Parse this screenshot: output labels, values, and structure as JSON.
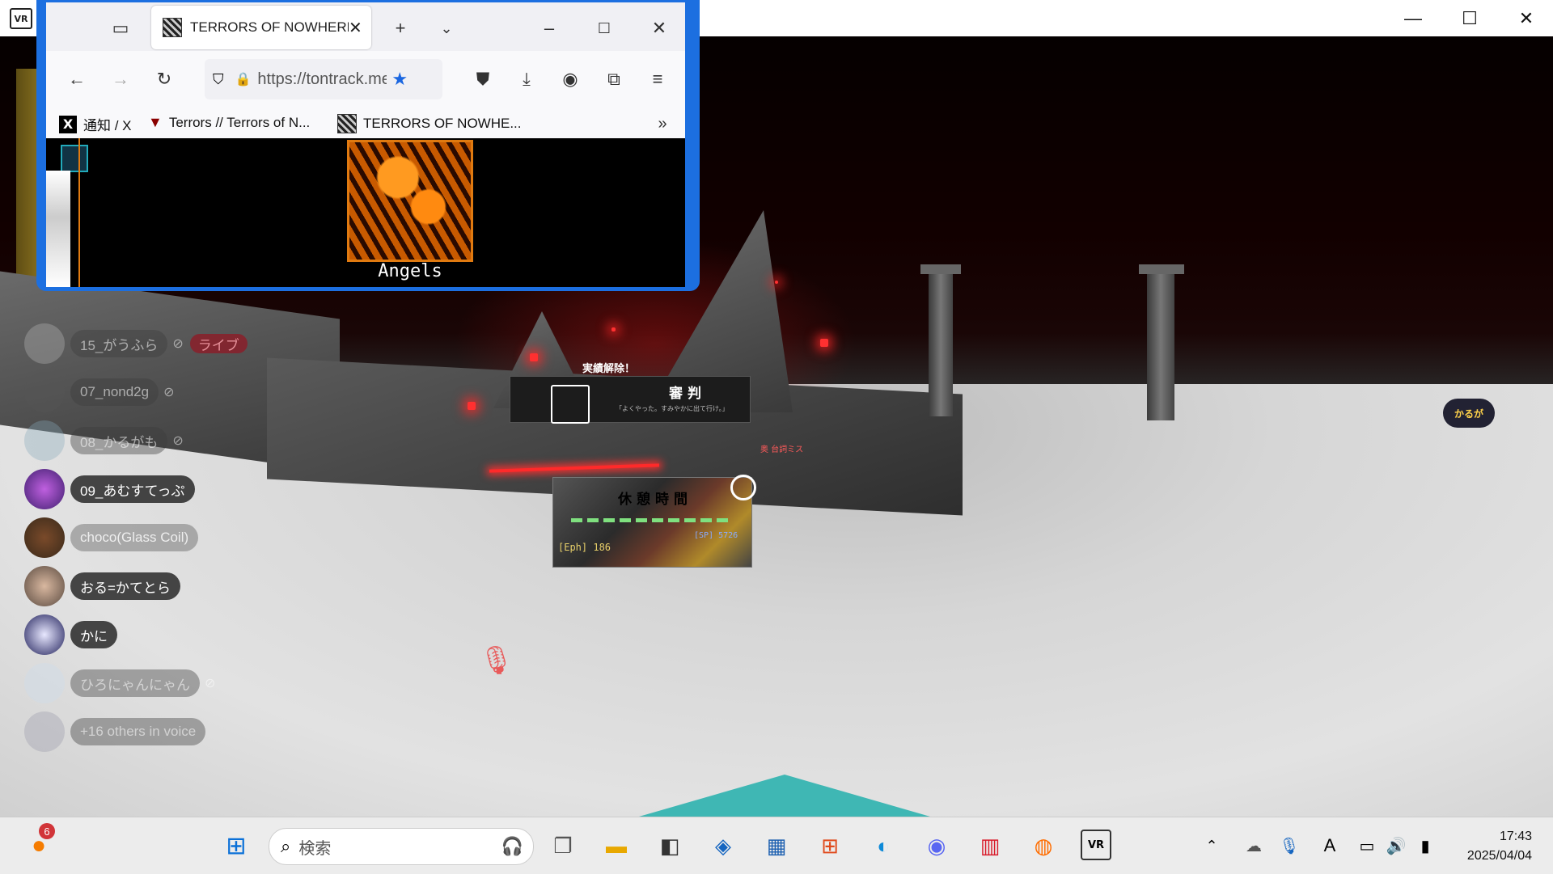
{
  "vr_window": {
    "app_icon_label": "VR",
    "controls": {
      "minimize": "—",
      "maximize": "☐",
      "close": "✕"
    }
  },
  "browser": {
    "tab_title": "TERRORS OF NOWHERE",
    "url": "https://tontrack.me",
    "bookmarks": [
      "通知 / X",
      "Terrors // Terrors of N...",
      "TERRORS OF NOWHE..."
    ],
    "content": {
      "terror_name": "Angels"
    }
  },
  "game_hud": {
    "panel_header": "実績解除！",
    "panel_title": "審判",
    "panel_subtitle": "「よくやった。すみやかに出て行け。」",
    "break_title": "休憩時間",
    "eph_label": "[Eph] 186",
    "sp_label": "[SP] 5726",
    "red_note": "奥 台詞ミス",
    "player_tag": "かるが"
  },
  "voice": {
    "members": [
      {
        "name": "15_がうふら",
        "muted": true,
        "live": "ライブ",
        "dim": true
      },
      {
        "name": "07_nond2g",
        "muted": true,
        "dim": true
      },
      {
        "name": "08_かるがも",
        "muted": true,
        "dim": true
      },
      {
        "name": "09_あむすてっぷ",
        "muted": false,
        "dim": false
      },
      {
        "name": "choco(Glass Coil)",
        "muted": false,
        "dim": false
      },
      {
        "name": "おる=かてとら",
        "muted": false,
        "dim": false
      },
      {
        "name": "かに",
        "muted": false,
        "dim": false
      },
      {
        "name": "ひろにゃんにゃん",
        "muted": true,
        "dim": true
      },
      {
        "name": "+16 others in voice",
        "muted": false,
        "dim": true
      }
    ]
  },
  "taskbar": {
    "notification_count": "6",
    "search_placeholder": "検索",
    "ime_label": "A",
    "time": "17:43",
    "date": "2025/04/04"
  }
}
